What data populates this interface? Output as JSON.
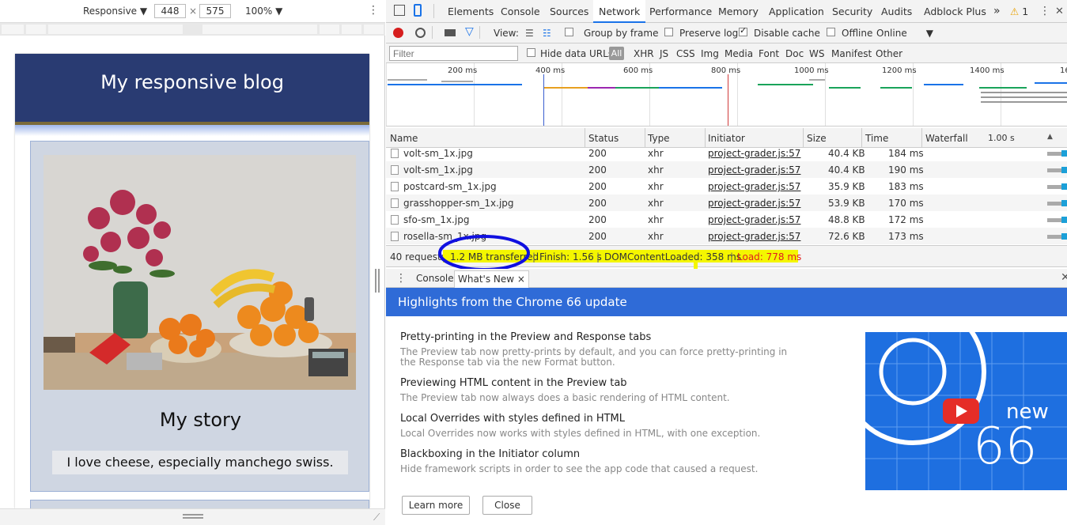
{
  "device": {
    "mode": "Responsive",
    "width": "448",
    "height": "575",
    "zoom": "100%",
    "times": "×"
  },
  "blog": {
    "title": "My responsive blog",
    "story_heading": "My story",
    "story_text": "I love cheese, especially manchego swiss."
  },
  "devtools": {
    "tabs": [
      "Elements",
      "Console",
      "Sources",
      "Network",
      "Performance",
      "Memory",
      "Application",
      "Security",
      "Audits",
      "Adblock Plus"
    ],
    "more": "»",
    "warnings": "1",
    "active_tab": "Network",
    "toolbar": {
      "view_label": "View:",
      "group_by_frame": "Group by frame",
      "preserve_log": "Preserve log",
      "disable_cache": "Disable cache",
      "offline": "Offline",
      "throttle": "Online",
      "disable_cache_checked": true
    },
    "filter": {
      "placeholder": "Filter",
      "hide_data_urls": "Hide data URLs",
      "all": "All",
      "types": [
        "XHR",
        "JS",
        "CSS",
        "Img",
        "Media",
        "Font",
        "Doc",
        "WS",
        "Manifest",
        "Other"
      ]
    },
    "overview_ticks": [
      "200 ms",
      "400 ms",
      "600 ms",
      "800 ms",
      "1000 ms",
      "1200 ms",
      "1400 ms",
      "16"
    ],
    "table": {
      "headers": [
        "Name",
        "Status",
        "Type",
        "Initiator",
        "Size",
        "Time",
        "Waterfall",
        "1.00 s"
      ],
      "rows": [
        {
          "name": "volt-sm_1x.jpg",
          "status": "200",
          "type": "xhr",
          "initiator": "project-grader.js:57",
          "size": "40.4 KB",
          "time": "184 ms"
        },
        {
          "name": "volt-sm_1x.jpg",
          "status": "200",
          "type": "xhr",
          "initiator": "project-grader.js:57",
          "size": "40.4 KB",
          "time": "190 ms"
        },
        {
          "name": "postcard-sm_1x.jpg",
          "status": "200",
          "type": "xhr",
          "initiator": "project-grader.js:57",
          "size": "35.9 KB",
          "time": "183 ms"
        },
        {
          "name": "grasshopper-sm_1x.jpg",
          "status": "200",
          "type": "xhr",
          "initiator": "project-grader.js:57",
          "size": "53.9 KB",
          "time": "170 ms"
        },
        {
          "name": "sfo-sm_1x.jpg",
          "status": "200",
          "type": "xhr",
          "initiator": "project-grader.js:57",
          "size": "48.8 KB",
          "time": "172 ms"
        },
        {
          "name": "rosella-sm_1x.jpg",
          "status": "200",
          "type": "xhr",
          "initiator": "project-grader.js:57",
          "size": "72.6 KB",
          "time": "173 ms"
        }
      ]
    },
    "summary": {
      "requests": "40 requests",
      "transferred": "1.2 MB transferred",
      "finish": "Finish: 1.56 s",
      "dcl": "DOMContentLoaded: 358 ms",
      "load": "Load: 778 ms",
      "sep": "|"
    },
    "drawer": {
      "console_tab": "Console",
      "whatsnew_tab": "What's New",
      "close": "×",
      "banner": "Highlights from the Chrome 66 update",
      "items": [
        {
          "title": "Pretty-printing in the Preview and Response tabs",
          "desc": "The Preview tab now pretty-prints by default, and you can force pretty-printing in the Response tab via the new Format button."
        },
        {
          "title": "Previewing HTML content in the Preview tab",
          "desc": "The Preview tab now always does a basic rendering of HTML content."
        },
        {
          "title": "Local Overrides with styles defined in HTML",
          "desc": "Local Overrides now works with styles defined in HTML, with one exception."
        },
        {
          "title": "Blackboxing in the Initiator column",
          "desc": "Hide framework scripts in order to see the app code that caused a request."
        }
      ],
      "learn_more": "Learn more",
      "close_button": "Close",
      "promo_new": "new",
      "promo_version": "66"
    }
  },
  "colors": {
    "blog_header": "#293b72",
    "card_bg": "#cfd6e2",
    "banner": "#2f6bd7",
    "highlight": "#f4f600",
    "annotation_circle": "#1010e0",
    "load_red": "#e02020"
  }
}
